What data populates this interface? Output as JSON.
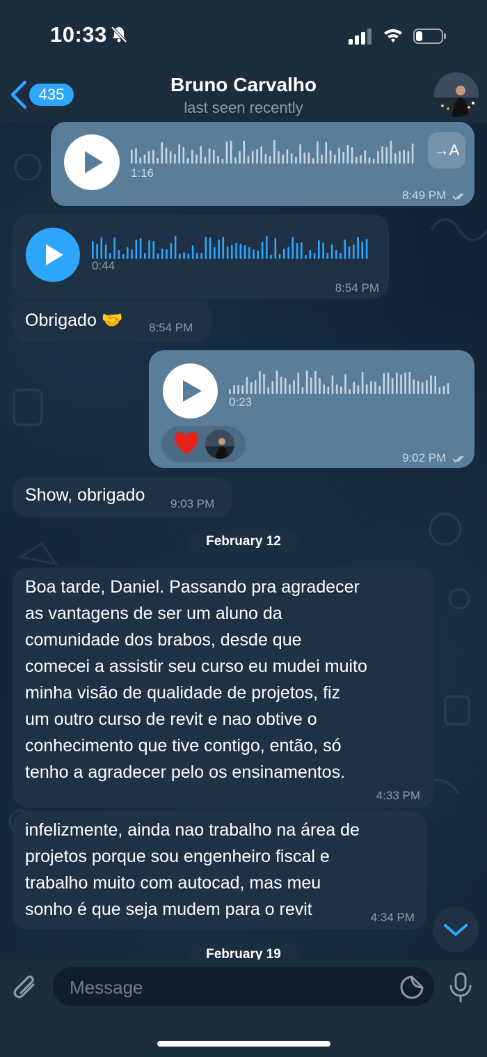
{
  "status_bar": {
    "time": "10:33"
  },
  "header": {
    "back_count": "435",
    "contact_name": "Bruno Carvalho",
    "contact_status": "last seen recently"
  },
  "messages": [
    {
      "type": "voice",
      "dir": "out",
      "duration": "1:16",
      "time": "8:49 PM",
      "read": true,
      "translate_label": "→A"
    },
    {
      "type": "voice",
      "dir": "in",
      "duration": "0:44",
      "time": "8:54 PM"
    },
    {
      "type": "text",
      "dir": "in",
      "text": "Obrigado 🤝",
      "time": "8:54 PM"
    },
    {
      "type": "voice",
      "dir": "out",
      "duration": "0:23",
      "time": "9:02 PM",
      "read": true,
      "reaction": "❤"
    },
    {
      "type": "text",
      "dir": "in",
      "text": "Show, obrigado",
      "time": "9:03 PM"
    },
    {
      "type": "date",
      "text": "February 12"
    },
    {
      "type": "text",
      "dir": "in",
      "lines": [
        "Boa tarde, Daniel. Passando pra agradecer",
        "as vantagens de ser um aluno da",
        "comunidade dos brabos, desde que",
        "comecei a assistir seu curso eu mudei muito",
        "minha visão de qualidade de projetos, fiz",
        "um outro curso de revit e nao obtive o",
        "conhecimento que tive contigo, então, só",
        "tenho a agradecer pelo os ensinamentos."
      ],
      "time": "4:33 PM"
    },
    {
      "type": "text",
      "dir": "in",
      "lines": [
        "infelizmente, ainda nao trabalho na área de",
        "projetos porque sou engenheiro fiscal e",
        "trabalho muito com autocad, mas meu",
        "sonho é que seja mudem para o revit"
      ],
      "time": "4:34 PM"
    },
    {
      "type": "date",
      "text": "February 19"
    }
  ],
  "input": {
    "placeholder": "Message"
  },
  "colors": {
    "accent": "#2ea6ff",
    "outgoing_bubble": "#5a7e99",
    "incoming_bubble": "#1f3245",
    "background": "#122536"
  }
}
